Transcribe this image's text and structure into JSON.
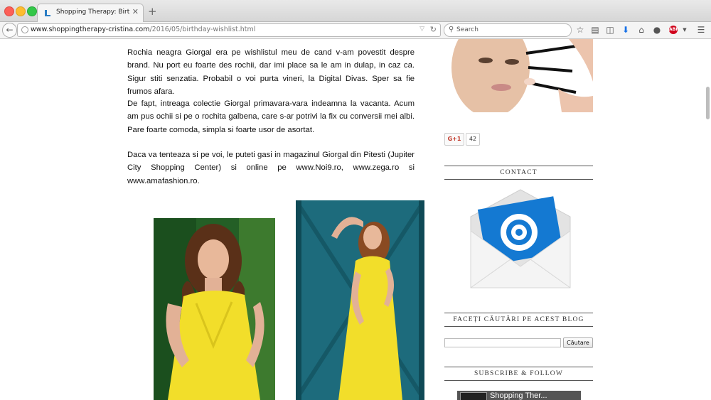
{
  "browser": {
    "tab": {
      "title": "Shopping Therapy: Birthd..."
    },
    "url": {
      "host": "www.shoppingtherapy-cristina.com",
      "path": "/2016/05/birthday-wishlist.html"
    },
    "search": {
      "placeholder": "Search"
    },
    "toolbar_icons": [
      "star-icon",
      "reading-list-icon",
      "pocket-icon",
      "download-icon",
      "home-icon",
      "chat-icon",
      "adblock-icon",
      "menu-icon"
    ],
    "abp_label": "ABP"
  },
  "article": {
    "paragraphs": [
      "Rochia neagra Giorgal era pe wishlistul meu de cand v-am povestit despre brand. Nu port eu foarte des rochii, dar imi place sa le am in dulap, in caz ca. Sigur stiti senzatia. Probabil o voi purta vineri, la Digital Divas. Sper sa fie frumos afara.",
      "De fapt, intreaga colectie Giorgal primavara-vara indeamna la vacanta. Acum am pus ochii si pe o rochita galbena, care s-ar potrivi la fix cu conversii mei albi. Pare foarte comoda, simpla si  foarte usor de asortat.",
      "Daca va tenteaza si pe voi, le puteti gasi in magazinul Giorgal din Pitesti (Jupiter City Shopping Center) si online pe www.Noi9.ro, www.zega.ro si www.amafashion.ro."
    ]
  },
  "sidebar": {
    "gplus_label": "G+1",
    "gplus_count": "42",
    "contact_title": "CONTACT",
    "search_title": "FACEȚI CĂUTĂRI PE ACEST BLOG",
    "search_button": "Căutare",
    "follow_title": "SUBSCRIBE & FOLLOW",
    "follow_name": "Shopping Ther..."
  },
  "colors": {
    "dress_yellow": "#f2de2a",
    "envelope_blue": "#1479d2"
  }
}
